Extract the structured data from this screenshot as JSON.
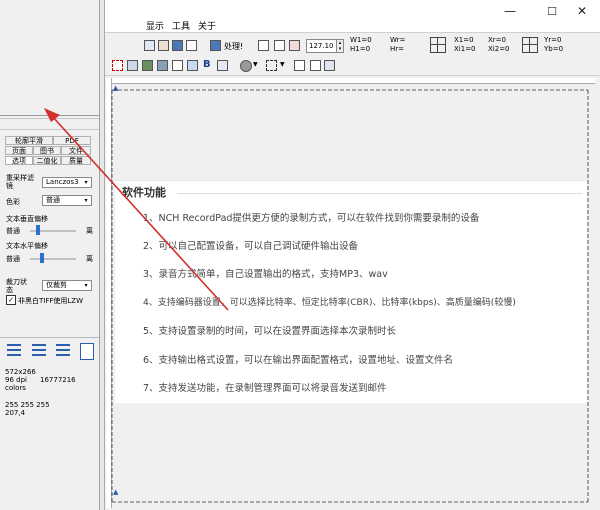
{
  "window": {
    "minimize_glyph": "—",
    "maximize_glyph": "☐",
    "close_glyph": "✕"
  },
  "menu": [
    {
      "label": "显示"
    },
    {
      "label": "工具"
    },
    {
      "label": "关于"
    }
  ],
  "toolbar1": {
    "process_label": "处理!",
    "zoom_value": "127.10",
    "coords": {
      "w1": "W1=0",
      "h1": "H1=0",
      "wr": "Wr=",
      "hr": "Hr=",
      "x1": "X1=0",
      "xi1": "Xi1=0",
      "xr": "Xr=0",
      "xi2": "Xi2=0",
      "yr": "Yr=0",
      "yb": "Yb=0"
    }
  },
  "left_panel": {
    "tabs_row1": [
      "轮廓平滑",
      "PDF"
    ],
    "tabs_row2": [
      "页面",
      "图书",
      "文件"
    ],
    "tabs_row3": [
      "选项",
      "二值化",
      "质量"
    ],
    "resample_label": "重采样滤镜",
    "resample_value": "Lanczos3",
    "color_label": "色彩",
    "color_value": "普通",
    "vertical_align_label": "文本垂直偏移",
    "vertical_normal": "普通",
    "vertical_far": "离",
    "horizontal_align_label": "文本水平偏移",
    "horizontal_normal": "普通",
    "horizontal_far": "离",
    "crop_label": "裁刀状态",
    "crop_value": "仅裁剪",
    "tiff_label": "非黑白TIFF使用LZW",
    "info": {
      "size": "572x266",
      "dpi": "96 dpi",
      "colors_count": "16777216",
      "colors_label": "colors",
      "rgb": "255 255 255",
      "pos": "207,4"
    }
  },
  "document": {
    "heading": "软件功能",
    "lines": [
      "1、NCH RecordPad提供更方便的录制方式，可以在软件找到你需要录制的设备",
      "2、可以自己配置设备，可以自己调试硬件输出设备",
      "3、录音方式简单，自己设置输出的格式，支持MP3、wav",
      "4、支持编码器设置，可以选择比特率、恒定比特率(CBR)、比特率(kbps)、高质量编码(较慢)",
      "5、支持设置录制的时间，可以在设置界面选择本次录制时长",
      "6、支持输出格式设置，可以在输出界面配置格式，设置地址、设置文件名",
      "7、支持发送功能，在录制管理界面可以将录音发送到邮件"
    ]
  },
  "colors": {
    "arrow": "#d32f2f",
    "panel_bg": "#f0f0f0",
    "canvas_bg": "#f0f0f0"
  }
}
